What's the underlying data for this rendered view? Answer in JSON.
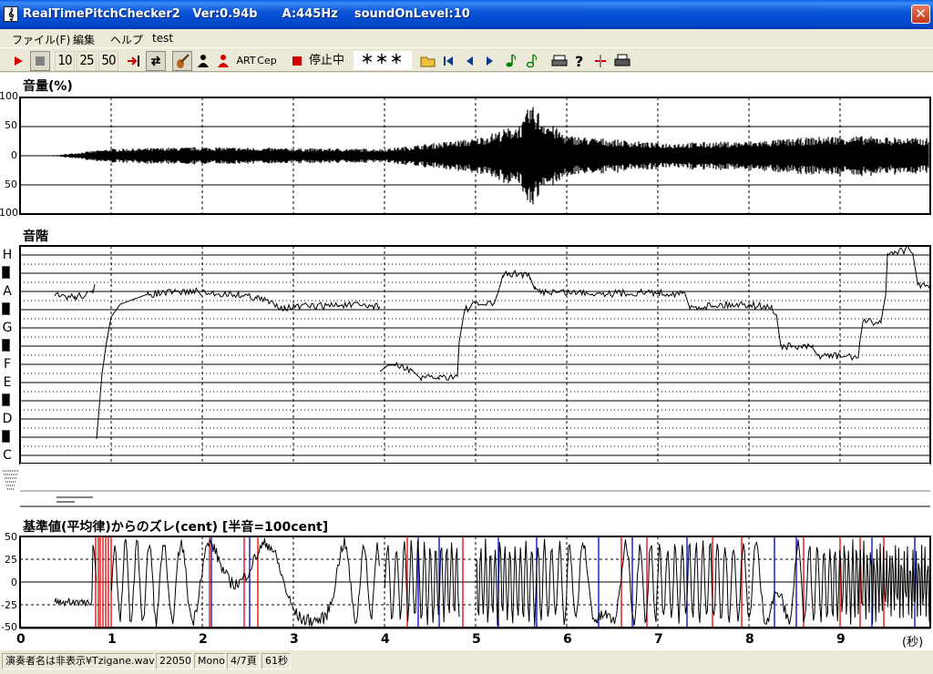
{
  "window": {
    "title": "RealTimePitchChecker2   Ver:0.94b      A:445Hz    soundOnLevel:10",
    "icon": "treble-clef-icon",
    "close_label": "✕"
  },
  "menu": [
    "ファイル(F)",
    "編集",
    "ヘルプ",
    "test"
  ],
  "toolbar": {
    "speed_10": "10",
    "speed_25": "25",
    "speed_50": "50",
    "art_label": "ART",
    "cep_label": "Cep",
    "status_text": "停止中",
    "note_display": "＊＊＊",
    "icons": [
      "play-icon",
      "stop-icon",
      "skip-to-end-icon",
      "loop-icon",
      "violin-icon",
      "person-black-icon",
      "person-red-icon",
      "record-stop-icon",
      "open-folder-icon",
      "first-page-icon",
      "prev-page-icon",
      "next-page-icon",
      "note-green-icon",
      "note-outline-icon",
      "print-icon",
      "help-icon",
      "split-icon",
      "printer-icon"
    ]
  },
  "volume_panel": {
    "title": "音量(%)",
    "y_labels": [
      "100",
      "50",
      "0",
      "50",
      "100"
    ]
  },
  "scale_panel": {
    "title": "音階",
    "notes": [
      "H",
      "A",
      "G",
      "F",
      "E",
      "D",
      "C"
    ]
  },
  "deviation_panel": {
    "title": "基準値(平均律)からのズレ(cent) [半音=100cent]",
    "y_labels": [
      "50",
      "25",
      "0",
      "-25",
      "-50"
    ]
  },
  "time_axis": {
    "labels": [
      "0",
      "1",
      "2",
      "3",
      "4",
      "5",
      "6",
      "7",
      "8",
      "9"
    ],
    "unit": "(秒)"
  },
  "statusbar": {
    "file": "演奏者名は非表示¥Tzigane.wav",
    "rate": "22050",
    "channels": "Mono",
    "page": "4/7頁",
    "duration": "61秒"
  },
  "colors": {
    "title_bar": "#0a55d8",
    "waveform": "#000000",
    "dev_red": "#e00000",
    "dev_blue": "#0000d0",
    "grid": "#000000"
  },
  "chart_data": [
    {
      "type": "area",
      "title": "音量(%)",
      "x_range": [
        0,
        10
      ],
      "ylim": [
        -100,
        100
      ],
      "description_series": [
        {
          "x": [
            0,
            0.4,
            1,
            2,
            3,
            4,
            5,
            5.5,
            5.6,
            6,
            7,
            8,
            9,
            10
          ],
          "amp": [
            0,
            1,
            12,
            15,
            13,
            12,
            30,
            55,
            80,
            35,
            22,
            25,
            35,
            30
          ]
        }
      ]
    },
    {
      "type": "line",
      "title": "音階",
      "x_range": [
        0,
        10
      ],
      "note_labels": [
        "H",
        "A",
        "G",
        "F",
        "E",
        "D",
        "C"
      ],
      "pitch_semitone_above_C": {
        "x": [
          0.4,
          0.8,
          0.85,
          1.0,
          1.2,
          2.0,
          2.8,
          2.9,
          4.0,
          4.0,
          4.4,
          4.8,
          4.85,
          5.0,
          5.3,
          5.6,
          5.7,
          7.0,
          7.3,
          8.0,
          8.3,
          8.7,
          9.2,
          9.5,
          9.8,
          10
        ]
      }
    },
    {
      "type": "line",
      "title": "基準値(平均律)からのズレ(cent) [半音=100cent]",
      "x_range": [
        0,
        10
      ],
      "ylim": [
        -50,
        50
      ]
    }
  ]
}
